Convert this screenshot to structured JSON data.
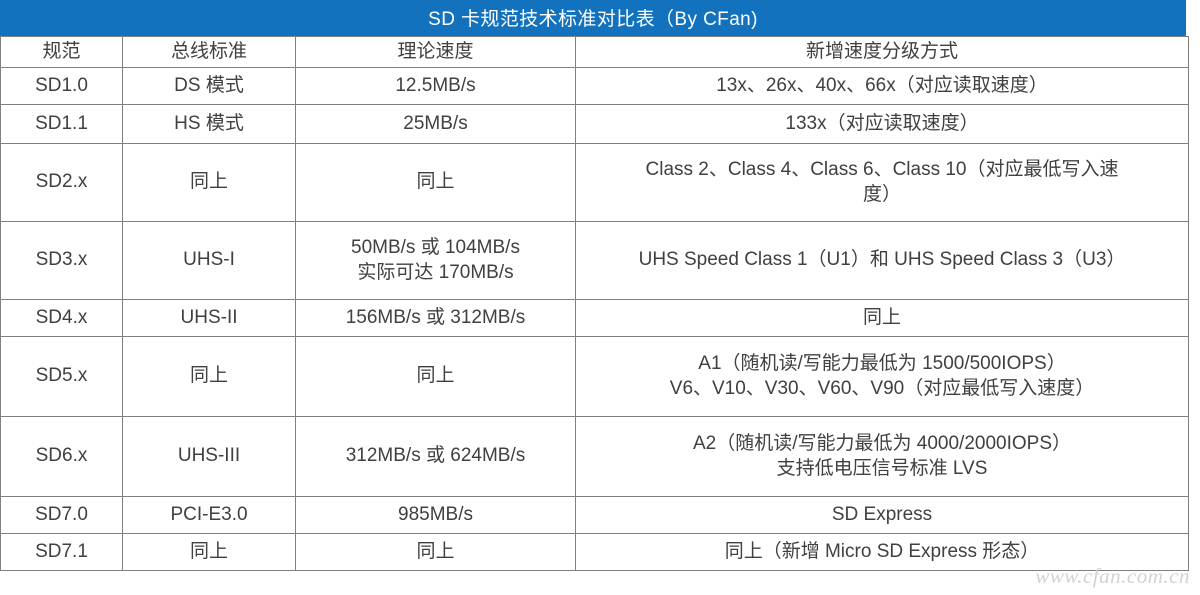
{
  "title_bar": {
    "title": "SD 卡规范技术标准对比表（By CFan)",
    "background_color": "#1272bd",
    "text_color": "#ffffff"
  },
  "table": {
    "border_color": "#7f7f7f",
    "text_color": "#404040",
    "columns": [
      {
        "key": "spec",
        "label": "规范"
      },
      {
        "key": "bus",
        "label": "总线标准"
      },
      {
        "key": "speed",
        "label": "理论速度"
      },
      {
        "key": "class",
        "label": "新增速度分级方式"
      }
    ],
    "rows": [
      {
        "spec": "SD1.0",
        "bus": "DS 模式",
        "speed": "12.5MB/s",
        "class": "13x、26x、40x、66x（对应读取速度）"
      },
      {
        "spec": "SD1.1",
        "bus": "HS 模式",
        "speed": "25MB/s",
        "class": "133x（对应读取速度）"
      },
      {
        "spec": "SD2.x",
        "bus": "同上",
        "speed": "同上",
        "class": "Class 2、Class 4、Class 6、Class 10（对应最低写入速\n度）"
      },
      {
        "spec": "SD3.x",
        "bus": "UHS-I",
        "speed": "50MB/s 或 104MB/s\n实际可达 170MB/s",
        "class": "UHS Speed Class 1（U1）和 UHS Speed Class 3（U3）"
      },
      {
        "spec": "SD4.x",
        "bus": "UHS-II",
        "speed": "156MB/s 或 312MB/s",
        "class": "同上"
      },
      {
        "spec": "SD5.x",
        "bus": "同上",
        "speed": "同上",
        "class": "A1（随机读/写能力最低为 1500/500IOPS）\nV6、V10、V30、V60、V90（对应最低写入速度）"
      },
      {
        "spec": "SD6.x",
        "bus": "UHS-III",
        "speed": "312MB/s 或 624MB/s",
        "class": "A2（随机读/写能力最低为 4000/2000IOPS）\n支持低电压信号标准 LVS"
      },
      {
        "spec": "SD7.0",
        "bus": "PCI-E3.0",
        "speed": "985MB/s",
        "class": "SD Express"
      },
      {
        "spec": "SD7.1",
        "bus": "同上",
        "speed": "同上",
        "class": "同上（新增 Micro SD Express 形态）"
      }
    ]
  },
  "watermark": {
    "text": "www.cfan.com.cn"
  }
}
